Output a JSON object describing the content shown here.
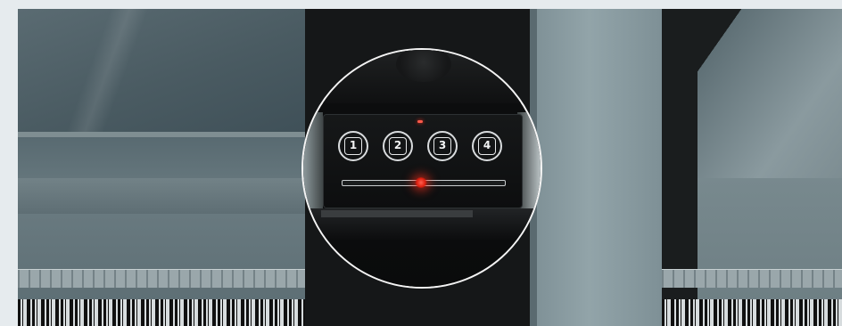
{
  "image": {
    "description_free": true
  },
  "control_panel": {
    "buttons": [
      {
        "label": "1"
      },
      {
        "label": "2"
      },
      {
        "label": "3"
      },
      {
        "label": "4"
      }
    ],
    "indicator_color": "#ff3020",
    "magnifier_border_color": "#f4f4f4"
  }
}
